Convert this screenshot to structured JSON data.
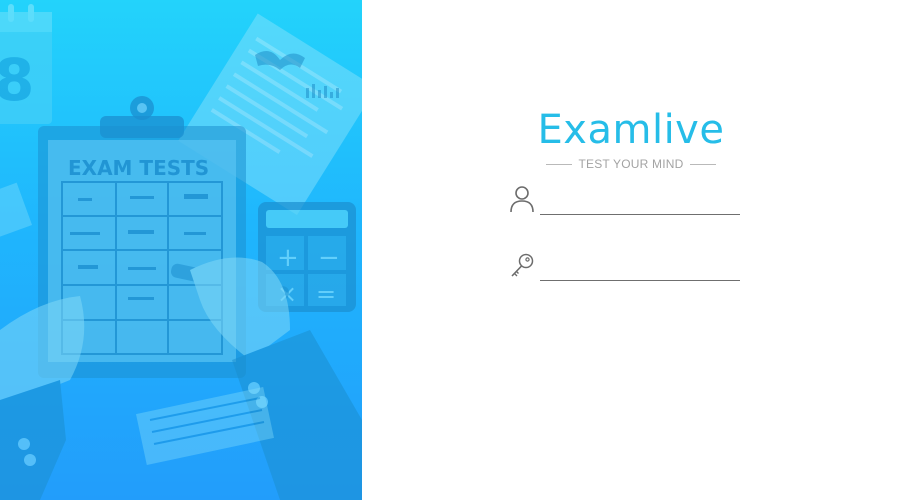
{
  "hero": {
    "clipboard_heading": "EXAM TESTS",
    "calendar_digit": "8",
    "calculator_keys": [
      "+",
      "−",
      "×",
      "="
    ]
  },
  "brand": {
    "title": "Examlive",
    "tagline": "TEST YOUR MIND"
  },
  "login": {
    "username": {
      "value": "",
      "icon": "user-icon"
    },
    "password": {
      "value": "",
      "icon": "key-icon"
    }
  },
  "colors": {
    "accent": "#26bde8",
    "hero_top": "#23d3fb",
    "hero_bottom": "#229dfb",
    "underline": "#6f6f6f",
    "tagline": "#a3a3a3"
  }
}
